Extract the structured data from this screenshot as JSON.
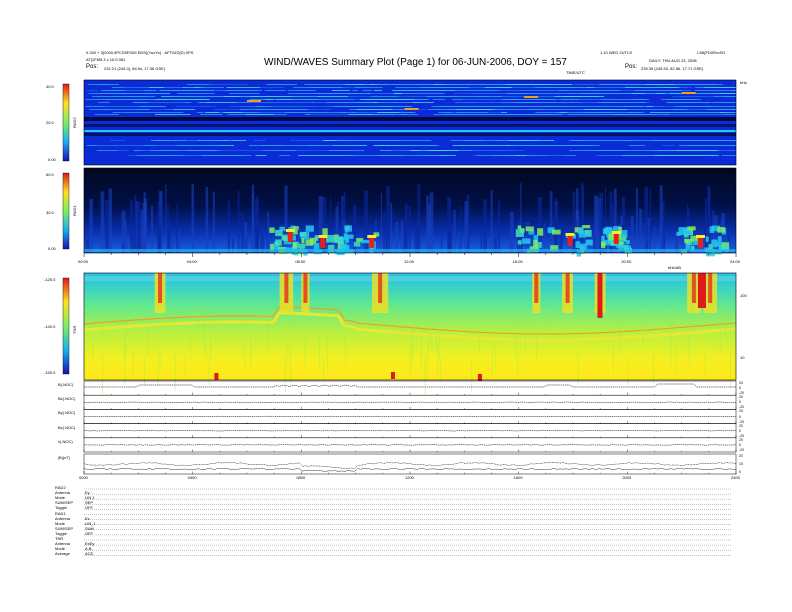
{
  "header": {
    "title": "WIND/WAVES Summary Plot (Page 1) for 06-JUN-2006, DOY = 157",
    "left_info_1": "0.330 + 3(2000.5PCS5F0D5 EDS)(YooYo) - AFT0ZZ(D) 0PS",
    "left_info_2": "AT[1FM5.3 x 10.0.081",
    "left_pos_label": "Pos:",
    "left_pos_value": "232.21 (244.0), 84.0s, 17.36 GSE)",
    "right_info_1": "1.10 WED 2UTC0",
    "right_info_2": "L3B(FD0RroSO",
    "right_info_3": "DAILY: THU AUG 23, 2008",
    "right_pos_label": "Pos:",
    "right_pos_value": "235.35 (245.53, 82.86, 17.71 GSE)",
    "time_label": "TIME/UTC"
  },
  "panels": {
    "rad2": {
      "label": "RAD2",
      "ticks": [
        "40.0",
        "20.0",
        "0.00"
      ],
      "right_tick": "kHz"
    },
    "rad1": {
      "label": "RAD1",
      "ticks": [
        "60.0",
        "30.0",
        "0.00"
      ]
    },
    "tnr": {
      "label": "TNR",
      "ticks": [
        "-125.0",
        "-140.0",
        "-155.0"
      ],
      "right_ticks": [
        "100",
        "10"
      ],
      "corner_label": "kHz/dB"
    }
  },
  "time_axis": {
    "ticks_main": [
      "00:00",
      "04:00",
      "08:00",
      "12:00",
      "16:00",
      "20:00",
      "24:00"
    ],
    "ticks_bottom": [
      "0000",
      "0400",
      "0800",
      "1200",
      "1600",
      "2000",
      "2400"
    ]
  },
  "mag_panels": [
    {
      "label": "B(.NOC)",
      "r_top": "20",
      "r_mid": "0",
      "r_bot": "-20"
    },
    {
      "label": "Bx(.NOC)",
      "r_top": "20",
      "r_mid": "0",
      "r_bot": "-20"
    },
    {
      "label": "By(.NOC)",
      "r_top": "20",
      "r_mid": "0",
      "r_bot": "-20"
    },
    {
      "label": "Bz(.NOC)",
      "r_top": "20",
      "r_mid": "0",
      "r_bot": "-20"
    },
    {
      "label": "λ(.NOC)",
      "r_top": "20",
      "r_mid": "0",
      "r_bot": "-20"
    },
    {
      "label": "|B|(nT)",
      "r_top": "20",
      "r_mid": "10",
      "r_bot": "0"
    }
  ],
  "instrument_params": [
    {
      "key": "RAD2",
      "val": ""
    },
    {
      "key": "Antenna",
      "val": "Ey"
    },
    {
      "key": "Mode",
      "val": "LIN 1"
    },
    {
      "key": "SUM/SEP",
      "val": "SEP"
    },
    {
      "key": "Toggle",
      "val": "OFF"
    },
    {
      "key": "RAD1",
      "val": ""
    },
    {
      "key": "Antenna",
      "val": "Ex"
    },
    {
      "key": "Mode",
      "val": "LIN_1"
    },
    {
      "key": "SUM/SEP",
      "val": "SUM"
    },
    {
      "key": "Toggle",
      "val": "OFF"
    },
    {
      "key": "TNR",
      "val": ""
    },
    {
      "key": "Antenna",
      "val": "ExEy"
    },
    {
      "key": "Mode",
      "val": "A,B,"
    },
    {
      "key": "Average",
      "val": "ACE,"
    }
  ],
  "chart_data": {
    "type": "heatmap",
    "title": "WIND/WAVES Summary Plot (Page 1) for 06-JUN-2006, DOY = 157",
    "xlabel": "TIME/UTC",
    "xlim": [
      0,
      24
    ],
    "x_ticks": [
      "00:00",
      "04:00",
      "08:00",
      "12:00",
      "16:00",
      "20:00",
      "24:00"
    ],
    "panels": [
      {
        "name": "RAD2",
        "ylim": [
          0,
          40
        ],
        "colorbar_unit": "dB"
      },
      {
        "name": "RAD1",
        "ylim": [
          0,
          60
        ],
        "colorbar_unit": "dB"
      },
      {
        "name": "TNR",
        "ylim": [
          -155,
          -125
        ],
        "colorbar_unit": "dB"
      }
    ],
    "colors": {
      "background_blue": "#0a2bd6",
      "dark": "#000a40",
      "cyan": "#22c8f0",
      "green": "#7cf060",
      "yellow": "#ffee22",
      "red": "#e8201a"
    }
  }
}
